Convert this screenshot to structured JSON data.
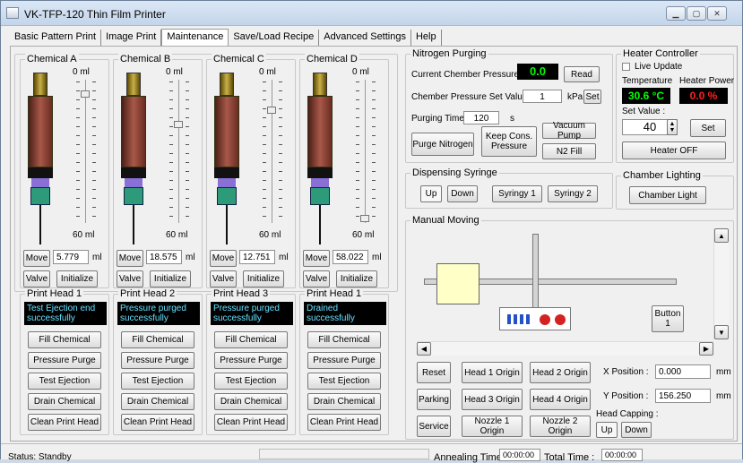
{
  "app": {
    "title": "VK-TFP-120 Thin Film Printer",
    "window_buttons": [
      "minimize-icon",
      "maximize-icon",
      "close-icon"
    ]
  },
  "tabs": [
    "Basic Pattern Print",
    "Image Print",
    "Maintenance",
    "Save/Load Recipe",
    "Advanced Settings",
    "Help"
  ],
  "chemicals": [
    {
      "title": "Chemical A",
      "top_label": "0 ml",
      "bottom_label": "60 ml",
      "move_label": "Move",
      "volume": "5.779",
      "unit": "ml",
      "valve_label": "Valve",
      "init_label": "Initialize",
      "level": 0.1
    },
    {
      "title": "Chemical B",
      "top_label": "0 ml",
      "bottom_label": "60 ml",
      "move_label": "Move",
      "volume": "18.575",
      "unit": "ml",
      "valve_label": "Valve",
      "init_label": "Initialize",
      "level": 0.31
    },
    {
      "title": "Chemical C",
      "top_label": "0 ml",
      "bottom_label": "60 ml",
      "move_label": "Move",
      "volume": "12.751",
      "unit": "ml",
      "valve_label": "Valve",
      "init_label": "Initialize",
      "level": 0.21
    },
    {
      "title": "Chemical D",
      "top_label": "0 ml",
      "bottom_label": "60 ml",
      "move_label": "Move",
      "volume": "58.022",
      "unit": "ml",
      "valve_label": "Valve",
      "init_label": "Initialize",
      "level": 0.97
    }
  ],
  "print_heads": [
    {
      "title": "Print Head 1",
      "status": "Test Ejection end successfully"
    },
    {
      "title": "Print Head 2",
      "status": "Pressure purged successfully"
    },
    {
      "title": "Print Head 3",
      "status": "Pressure purged successfully"
    },
    {
      "title": "Print Head 1",
      "status": "Drained successfully"
    }
  ],
  "head_buttons": [
    "Fill Chemical",
    "Pressure Purge",
    "Test Ejection",
    "Drain Chemical",
    "Clean Print Head"
  ],
  "nitrogen": {
    "title": "Nitrogen Purging",
    "current_label": "Current Chember Pressure :",
    "current_value": "0.0",
    "read": "Read",
    "setval_label": "Chember Pressure Set Value :",
    "setval": "1",
    "setval_unit": "kPa",
    "set": "Set",
    "purge_time_label": "Purging Time:",
    "purge_time": "120",
    "purge_time_unit": "s",
    "purge_btn": "Purge Nitrogen",
    "keep_btn": "Keep Cons. Pressure",
    "vacuum_btn": "Vacuum Pump",
    "n2fill_btn": "N2 Fill"
  },
  "heater": {
    "title": "Heater Controller",
    "live_update": "Live Update",
    "temp_label": "Temperature",
    "power_label": "Heater Power",
    "temp": "30.6 °C",
    "power": "0.0 %",
    "set_value_label": "Set Value :",
    "set_value": "40",
    "set": "Set",
    "off_btn": "Heater OFF"
  },
  "dispensing": {
    "title": "Dispensing Syringe",
    "up": "Up",
    "down": "Down",
    "syr1": "Syringy 1",
    "syr2": "Syringy 2"
  },
  "lighting": {
    "title": "Chamber Lighting",
    "btn": "Chamber Light"
  },
  "manual": {
    "title": "Manual Moving",
    "button1": "Button 1",
    "reset": "Reset",
    "h1o": "Head 1 Origin",
    "h2o": "Head 2 Origin",
    "parking": "Parking",
    "h3o": "Head 3 Origin",
    "h4o": "Head 4 Origin",
    "service": "Service",
    "n1o": "Nozzle 1 Origin",
    "n2o": "Nozzle 2 Origin",
    "xpos_label": "X Position :",
    "xpos": "0.000",
    "ypos_label": "Y Position :",
    "ypos": "156.250",
    "unit": "mm",
    "capping_label": "Head Capping :",
    "cap_up": "Up",
    "cap_down": "Down"
  },
  "statusbar": {
    "status": "Status:  Standby",
    "anneal_label": "Annealing Time :",
    "anneal": "00:00:00",
    "total_label": "Total Time :",
    "total": "00:00:00"
  },
  "colors": {
    "status_bg": "#000000",
    "status_text": "#66e0ff",
    "green_digits": "#00ff00",
    "red_digits": "#ff2020"
  }
}
